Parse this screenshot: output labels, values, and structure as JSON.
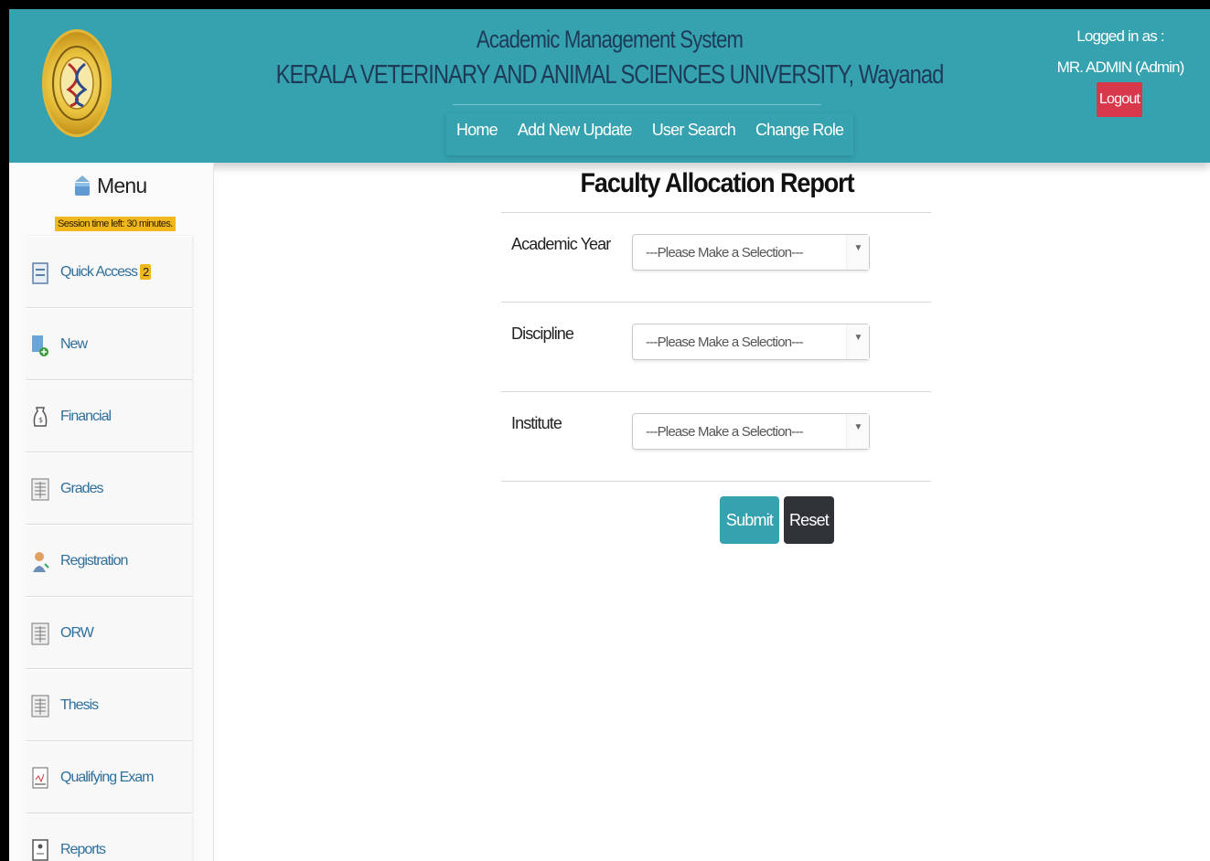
{
  "header": {
    "system_title": "Academic Management System",
    "university": "KERALA VETERINARY AND ANIMAL SCIENCES UNIVERSITY, Wayanad",
    "nav": [
      "Home",
      "Add New Update",
      "User Search",
      "Change Role"
    ],
    "logged_in_label": "Logged in as :",
    "user": "MR. ADMIN (Admin)",
    "logout_label": "Logout",
    "accent_color": "#36a2b0"
  },
  "sidebar": {
    "title": "Menu",
    "session_text": "Session time left: 30 minutes.",
    "items": [
      {
        "label": "Quick Access",
        "badge": "2",
        "icon": "quick-access-icon"
      },
      {
        "label": "New",
        "icon": "new-doc-icon"
      },
      {
        "label": "Financial",
        "icon": "financial-icon"
      },
      {
        "label": "Grades",
        "icon": "grades-icon"
      },
      {
        "label": "Registration",
        "icon": "registration-icon"
      },
      {
        "label": "ORW",
        "icon": "orw-icon"
      },
      {
        "label": "Thesis",
        "icon": "thesis-icon"
      },
      {
        "label": "Qualifying Exam",
        "icon": "qualifying-exam-icon"
      },
      {
        "label": "Reports",
        "icon": "reports-icon"
      }
    ]
  },
  "main": {
    "title": "Faculty Allocation Report",
    "fields": [
      {
        "label": "Academic Year",
        "value": "---Please Make a Selection---"
      },
      {
        "label": "Discipline",
        "value": "---Please Make a Selection---"
      },
      {
        "label": "Institute",
        "value": "---Please Make a Selection---"
      }
    ],
    "submit_label": "Submit",
    "reset_label": "Reset"
  }
}
